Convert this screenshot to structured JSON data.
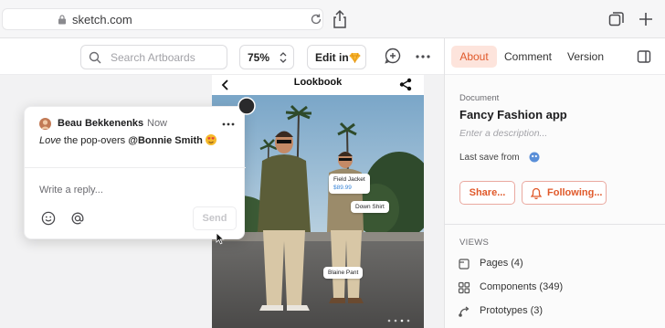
{
  "browser": {
    "url": "sketch.com"
  },
  "toolbar": {
    "search_placeholder": "Search Artboards",
    "zoom": "75%",
    "edit_label": "Edit in"
  },
  "panel": {
    "tabs": [
      "About",
      "Comment",
      "Version"
    ],
    "document_label": "Document",
    "document_title": "Fancy Fashion app",
    "description_placeholder": "Enter a description...",
    "last_save_label": "Last save from",
    "share_label": "Share...",
    "following_label": "Following...",
    "views_label": "VIEWS",
    "views": [
      {
        "label": "Pages (4)",
        "icon": "pages-icon"
      },
      {
        "label": "Components (349)",
        "icon": "components-icon"
      },
      {
        "label": "Prototypes (3)",
        "icon": "prototypes-icon"
      }
    ]
  },
  "artboard": {
    "title": "Lookbook",
    "tags": {
      "jacket": "Field Jacket",
      "jacket_price": "$89.99",
      "shirt": "Down Shirt",
      "pant": "Blaine Pant"
    }
  },
  "comment": {
    "author": "Beau Bekkenenks",
    "time": "Now",
    "body_italic": "Love",
    "body_text": " the pop-overs ",
    "mention": "@Bonnie Smith",
    "reply_placeholder": "Write a reply...",
    "send_label": "Send"
  },
  "colors": {
    "accent": "#e0592a",
    "accent_bg": "#fde4dc",
    "price": "#3a86d8"
  }
}
